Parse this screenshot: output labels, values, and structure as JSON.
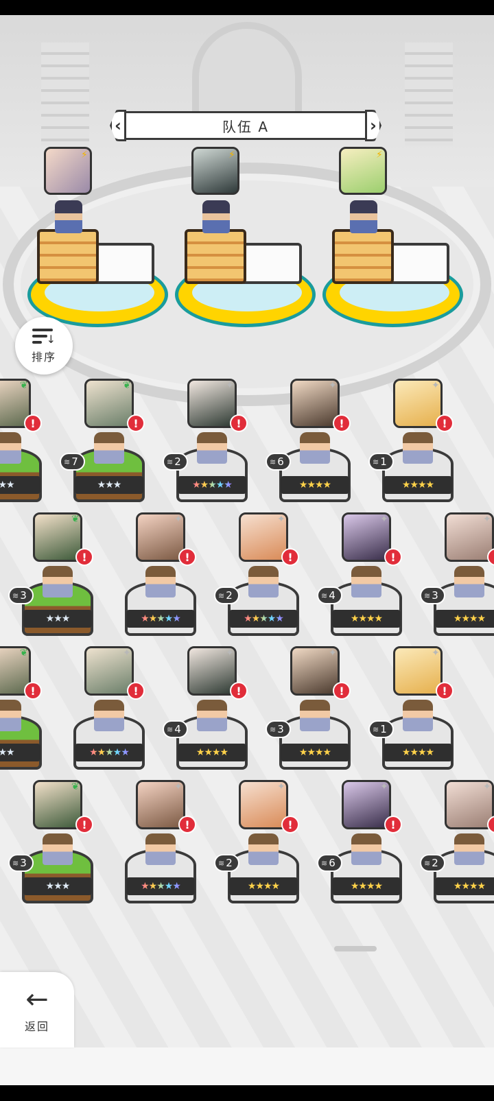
{
  "team": {
    "title": "队伍 A"
  },
  "sort": {
    "label": "排序"
  },
  "back": {
    "label": "返回"
  },
  "team_slots": [
    {
      "element_icon": "bolt-icon"
    },
    {
      "element_icon": "bolt-icon"
    },
    {
      "element_icon": "bolt-icon"
    }
  ],
  "rows": [
    [
      {
        "level": "",
        "stars": "★★",
        "element": "leaf"
      },
      {
        "level": "7",
        "stars": "★★★",
        "element": "leaf"
      },
      {
        "level": "2",
        "stars": "★★★★★",
        "element": "sparkle"
      },
      {
        "level": "6",
        "stars": "★★★★",
        "element": "sparkle"
      },
      {
        "level": "1",
        "stars": "★★★★",
        "element": "sparkle"
      }
    ],
    [
      {
        "level": "3",
        "stars": "★★★",
        "element": "leaf"
      },
      {
        "level": "",
        "stars": "★★★★★",
        "element": "sparkle"
      },
      {
        "level": "2",
        "stars": "★★★★★",
        "element": "sparkle"
      },
      {
        "level": "4",
        "stars": "★★★★",
        "element": "sparkle"
      },
      {
        "level": "3",
        "stars": "★★★★",
        "element": "sparkle"
      }
    ],
    [
      {
        "level": "",
        "stars": "★★",
        "element": "leaf"
      },
      {
        "level": "",
        "stars": "★★★★★",
        "element": "sparkle"
      },
      {
        "level": "4",
        "stars": "★★★★",
        "element": "sparkle"
      },
      {
        "level": "3",
        "stars": "★★★★",
        "element": "sparkle"
      },
      {
        "level": "1",
        "stars": "★★★★",
        "element": "sparkle"
      }
    ],
    [
      {
        "level": "3",
        "stars": "★★★",
        "element": "leaf"
      },
      {
        "level": "",
        "stars": "★★★★★",
        "element": "sparkle"
      },
      {
        "level": "2",
        "stars": "★★★★",
        "element": "sparkle"
      },
      {
        "level": "6",
        "stars": "★★★★",
        "element": "sparkle"
      },
      {
        "level": "2",
        "stars": "★★★★",
        "element": "sparkle"
      }
    ]
  ]
}
